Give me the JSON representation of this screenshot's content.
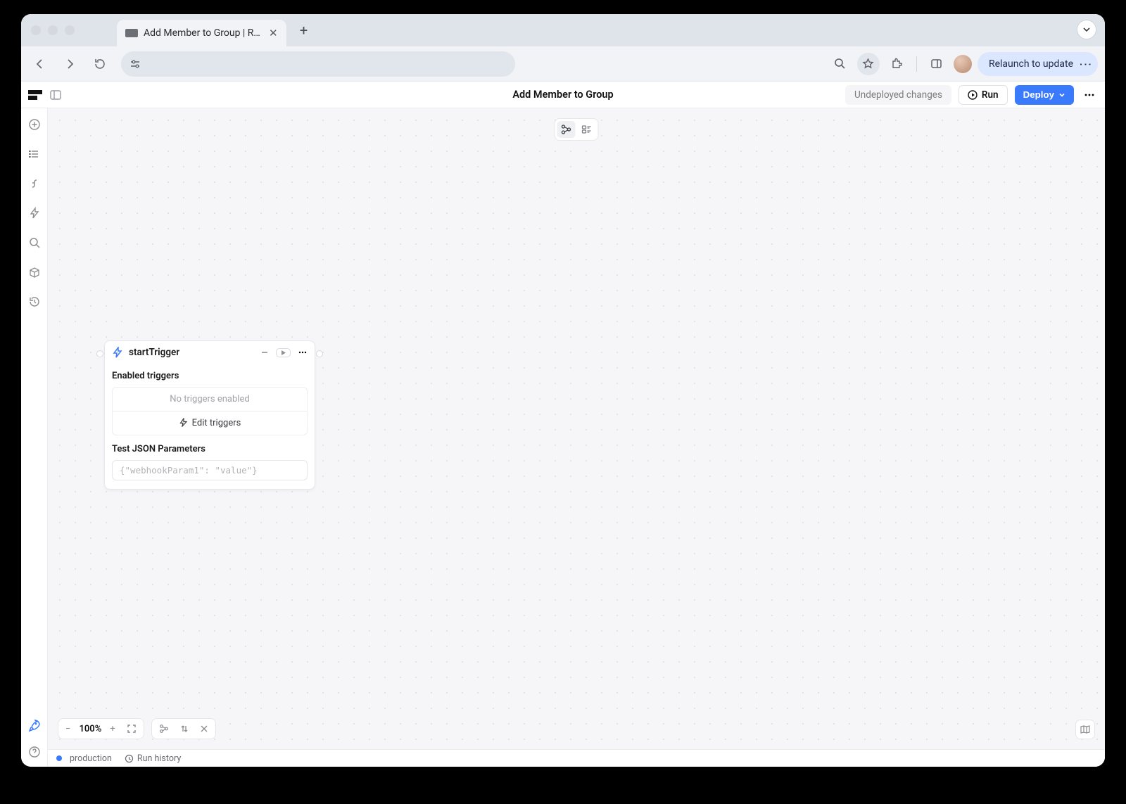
{
  "browser": {
    "tab_title": "Add Member to Group | Retoo",
    "relaunch_label": "Relaunch to update"
  },
  "app": {
    "title": "Add Member to Group",
    "undeployed_label": "Undeployed changes",
    "run_label": "Run",
    "deploy_label": "Deploy"
  },
  "node": {
    "name": "startTrigger",
    "section_triggers": "Enabled triggers",
    "no_triggers": "No triggers enabled",
    "edit_triggers": "Edit triggers",
    "section_params": "Test JSON Parameters",
    "params_placeholder": "{\"webhookParam1\": \"value\"}"
  },
  "canvas": {
    "zoom": "100%"
  },
  "status": {
    "env": "production",
    "run_history": "Run history"
  }
}
